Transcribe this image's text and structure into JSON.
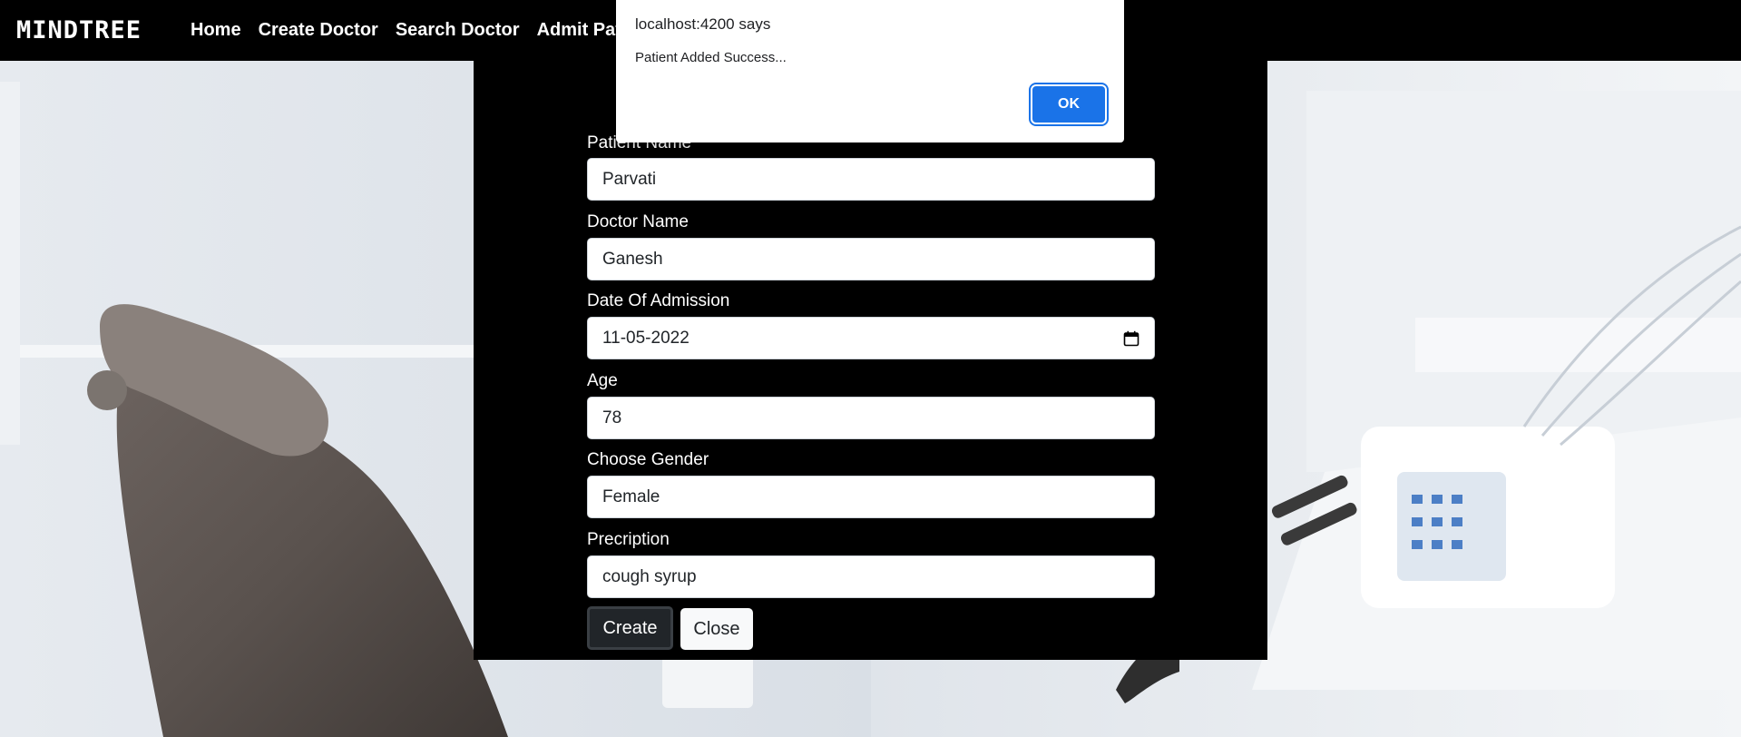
{
  "navbar": {
    "brand": "MINDTREE",
    "links": [
      "Home",
      "Create Doctor",
      "Search Doctor",
      "Admit Patie"
    ]
  },
  "form": {
    "fields": [
      {
        "label": "Patient Name",
        "value": "Parvati"
      },
      {
        "label": "Doctor Name",
        "value": "Ganesh"
      },
      {
        "label": "Date Of Admission",
        "value": "11-05-2022",
        "icon": "calendar-icon"
      },
      {
        "label": "Age",
        "value": "78"
      },
      {
        "label": "Choose Gender",
        "value": "Female"
      },
      {
        "label": "Precription",
        "value": "cough syrup"
      }
    ],
    "create_label": "Create",
    "close_label": "Close"
  },
  "dialog": {
    "title": "localhost:4200 says",
    "message": "Patient Added Success...",
    "ok_label": "OK"
  },
  "colors": {
    "navbar_bg": "#000000",
    "panel_bg": "#000000",
    "ok_button": "#1a73e8",
    "create_button": "#212529"
  }
}
